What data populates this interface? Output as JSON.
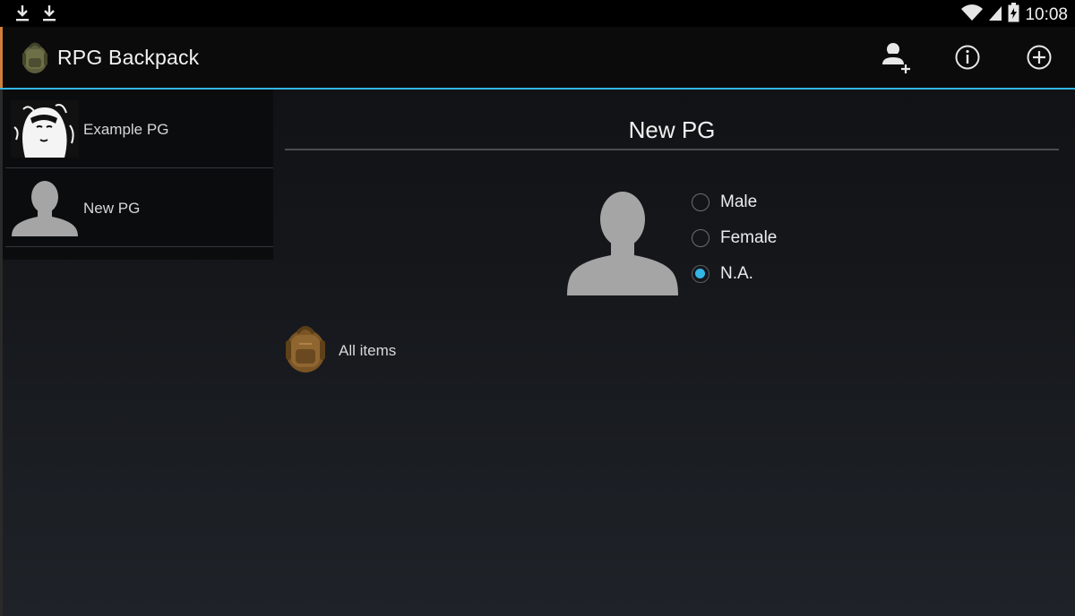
{
  "status_bar": {
    "left_icons": [
      "download-icon",
      "download-icon"
    ],
    "right_icons": [
      "wifi-icon",
      "signal-icon",
      "battery-icon"
    ],
    "time": "10:08"
  },
  "action_bar": {
    "app_icon": "backpack-icon",
    "title": "RPG Backpack",
    "actions": [
      {
        "icon": "add-person-icon"
      },
      {
        "icon": "info-icon"
      },
      {
        "icon": "add-circle-icon"
      }
    ]
  },
  "character_list": [
    {
      "name": "Example PG",
      "avatar": "portrait-photo"
    },
    {
      "name": "New PG",
      "avatar": "default-person-silhouette"
    }
  ],
  "detail": {
    "title": "New PG",
    "gender_options": [
      {
        "label": "Male",
        "checked": false
      },
      {
        "label": "Female",
        "checked": false
      },
      {
        "label": "N.A.",
        "checked": true
      }
    ],
    "inventory_link": {
      "label": "All items",
      "icon": "backpack-icon"
    }
  },
  "colors": {
    "accent": "#33b5e5",
    "silhouette": "#a5a5a5",
    "background": "#15171b"
  }
}
